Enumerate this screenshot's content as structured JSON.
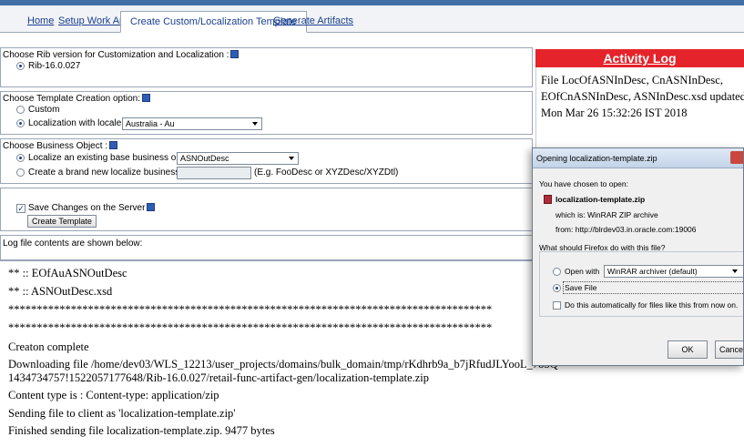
{
  "tabs": [
    {
      "label": "Home"
    },
    {
      "label": "Setup Work Areas"
    },
    {
      "label": "Create Custom/Localization Template"
    },
    {
      "label": "Generate Artifacts"
    }
  ],
  "rib": {
    "heading": "Choose Rib version for Customization and Localization :",
    "option": "Rib-16.0.027"
  },
  "template": {
    "heading": "Choose Template Creation option:",
    "option_custom": "Custom",
    "option_localization": "Localization with locale",
    "locale_value": "Australia - Au"
  },
  "business": {
    "heading": "Choose Business Object :",
    "option_existing": "Localize an existing base business object :",
    "existing_value": "ASNOutDesc",
    "option_new": "Create a brand new localize business object :",
    "new_hint": "(E.g. FooDesc or XYZDesc/XYZDtl)"
  },
  "save": {
    "checkbox_label": "Save Changes on the Server",
    "button_label": "Create Template"
  },
  "log_header": "Log file contents are shown below:",
  "log_lines": [
    "** :: EOfAuASNOutDesc",
    "** :: ASNOutDesc.xsd",
    "*************************************************************************************",
    "*************************************************************************************",
    "Creaton complete",
    "Downloading file /home/dev03/WLS_12213/user_projects/domains/bulk_domain/tmp/rKdhrb9a_b7jRfudJLYooL_7o5Q",
    "1434734757!1522057177648/Rib-16.0.027/retail-func-artifact-gen/localization-template.zip",
    "Content type is : Content-type: application/zip",
    "Sending file to client as 'localization-template.zip'",
    "Finished sending file localization-template.zip. 9477 bytes"
  ],
  "activity_log": {
    "title": "Activity Log",
    "lines": [
      "File LocOfASNInDesc, CnASNInDesc,",
      "EOfCnASNInDesc, ASNInDesc.xsd updated or",
      "Mon Mar 26 15:32:26 IST 2018"
    ]
  },
  "dialog": {
    "title": "Opening localization-template.zip",
    "chosen_text": "You have chosen to open:",
    "file_name": "localization-template.zip",
    "which_is": "which is: WinRAR ZIP archive",
    "from": "from: http://blrdev03.in.oracle.com:19006",
    "question": "What should Firefox do with this file?",
    "open_with_label": "Open with",
    "open_with_value": "WinRAR archiver (default)",
    "save_file_label": "Save File",
    "auto_label": "Do this automatically for files like this from now on.",
    "ok_label": "OK",
    "cancel_label": "Cance"
  }
}
